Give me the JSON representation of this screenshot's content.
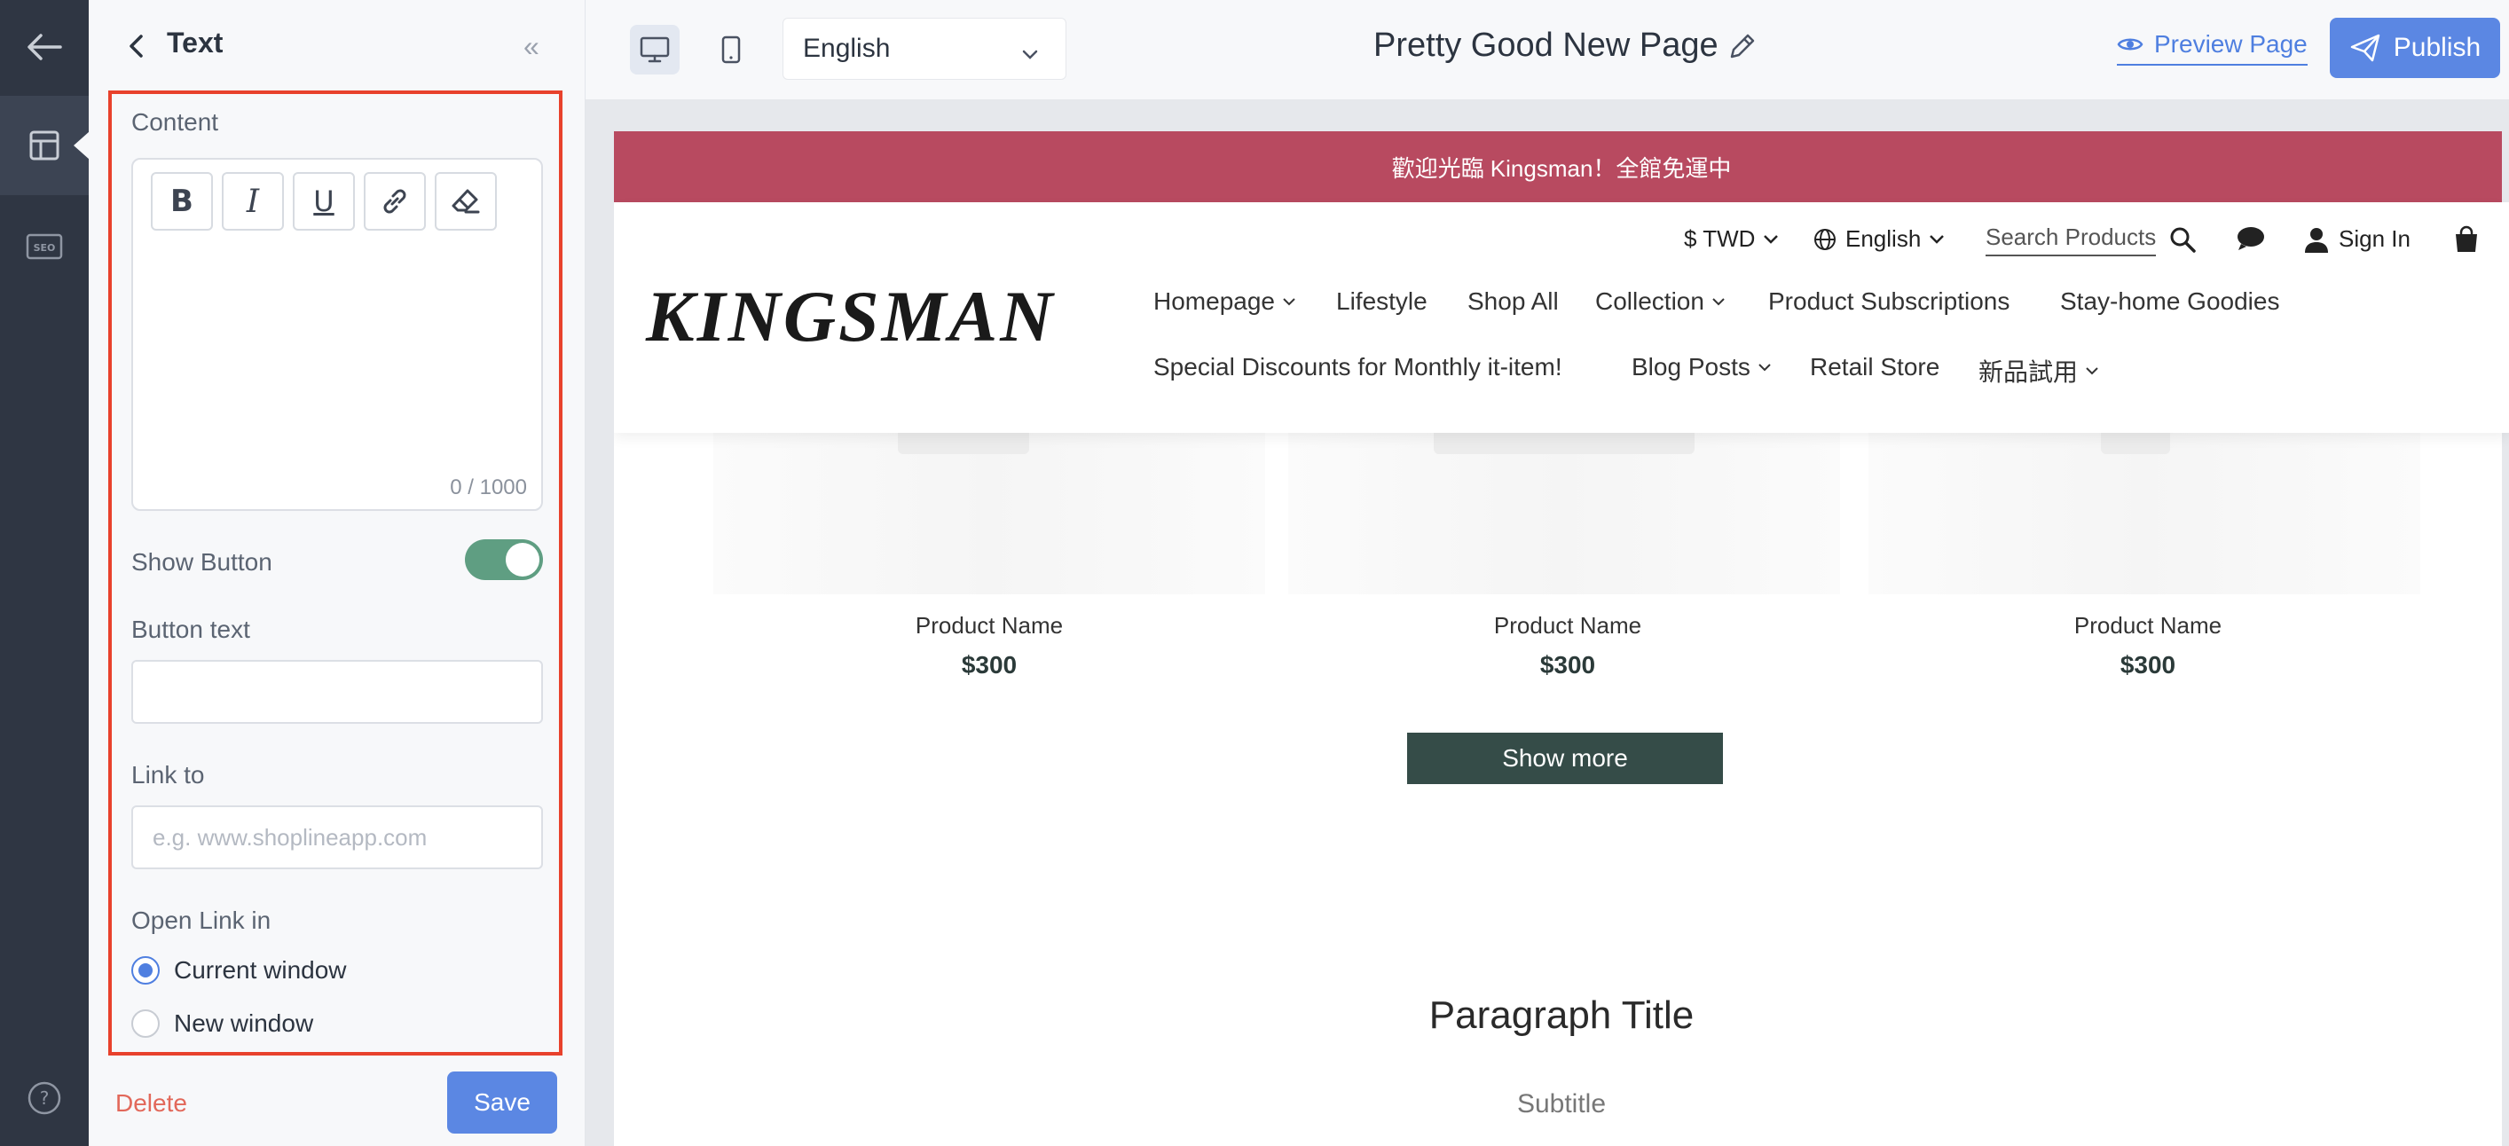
{
  "panel": {
    "title": "Text",
    "content_label": "Content",
    "counter": "0 / 1000",
    "show_button_label": "Show Button",
    "show_button_on": true,
    "button_text_label": "Button text",
    "button_text_value": "",
    "link_to_label": "Link to",
    "link_placeholder": "e.g. www.shoplineapp.com",
    "open_link_label": "Open Link in",
    "open_link_options": [
      "Current window",
      "New window"
    ],
    "open_link_selected": "Current window",
    "delete_label": "Delete",
    "save_label": "Save"
  },
  "topbar": {
    "language": "English",
    "page_title": "Pretty Good New Page",
    "preview_label": "Preview Page",
    "publish_label": "Publish"
  },
  "store": {
    "announcement": "歡迎光臨 Kingsman！全館免運中",
    "logo": "KINGSMAN",
    "currency": "$ TWD",
    "language": "English",
    "search_placeholder": "Search Products",
    "sign_in": "Sign In",
    "nav": {
      "homepage": "Homepage",
      "lifestyle": "Lifestyle",
      "shop_all": "Shop All",
      "collection": "Collection",
      "subscriptions": "Product Subscriptions",
      "stay_home": "Stay-home Goodies",
      "discounts": "Special Discounts for Monthly it-item!",
      "blog": "Blog Posts",
      "retail": "Retail Store",
      "new_trial": "新品試用"
    },
    "products": [
      {
        "name": "Product Name",
        "price": "$300"
      },
      {
        "name": "Product Name",
        "price": "$300"
      },
      {
        "name": "Product Name",
        "price": "$300"
      }
    ],
    "show_more": "Show more",
    "paragraph_title": "Paragraph Title",
    "subtitle": "Subtitle"
  },
  "colors": {
    "accent": "#5b87e3",
    "highlight": "#e8412c",
    "announcement_bg": "#b84a60",
    "toggle_on": "#5f9e82",
    "show_more_bg": "#354c48"
  }
}
